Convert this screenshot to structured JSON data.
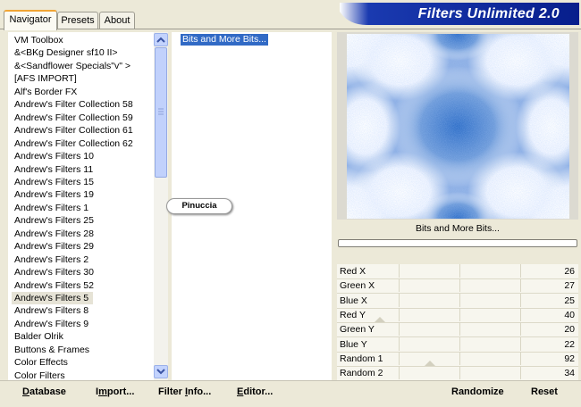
{
  "tabs": [
    {
      "label": "Navigator",
      "active": true
    },
    {
      "label": "Presets",
      "active": false
    },
    {
      "label": "About",
      "active": false
    }
  ],
  "header": {
    "title": "Filters Unlimited 2.0"
  },
  "categories": [
    "VM Toolbox",
    "&<BKg Designer sf10 II>",
    "&<Sandflower Specials\"v\" >",
    "[AFS IMPORT]",
    "Alf's Border FX",
    "Andrew's Filter Collection 58",
    "Andrew's Filter Collection 59",
    "Andrew's Filter Collection 61",
    "Andrew's Filter Collection 62",
    "Andrew's Filters 10",
    "Andrew's Filters 11",
    "Andrew's Filters 15",
    "Andrew's Filters 19",
    "Andrew's Filters 1",
    "Andrew's Filters 25",
    "Andrew's Filters 28",
    "Andrew's Filters 29",
    "Andrew's Filters 2",
    "Andrew's Filters 30",
    "Andrew's Filters 52",
    "Andrew's Filters 5",
    "Andrew's Filters 8",
    "Andrew's Filters 9",
    "Balder Olrik",
    "Buttons & Frames",
    "Color Effects",
    "Color Filters"
  ],
  "selected_category": "Andrew's Filters 5",
  "filters": [
    "Bits and More Bits..."
  ],
  "watermark": "Pinuccia",
  "preview": {
    "label": "Bits and More Bits..."
  },
  "params": [
    {
      "name": "Red X",
      "value": "26"
    },
    {
      "name": "Green X",
      "value": "27"
    },
    {
      "name": "Blue X",
      "value": "25"
    },
    {
      "name": "Red Y",
      "value": "40"
    },
    {
      "name": "Green Y",
      "value": "20"
    },
    {
      "name": "Blue Y",
      "value": "22"
    },
    {
      "name": "Random 1",
      "value": "92"
    },
    {
      "name": "Random 2",
      "value": "34"
    }
  ],
  "buttons": {
    "database": {
      "u": "D",
      "rest": "atabase"
    },
    "import": {
      "pre": "I",
      "u": "m",
      "rest": "port..."
    },
    "filter_info": {
      "pre": "Filter ",
      "u": "I",
      "rest": "nfo..."
    },
    "editor": {
      "u": "E",
      "rest": "ditor..."
    },
    "randomize": "Randomize",
    "reset": "Reset"
  },
  "colors": {
    "selection": "#316ac5",
    "scrollbar": "#c1d1fc",
    "banner": "#0a2a9a"
  }
}
